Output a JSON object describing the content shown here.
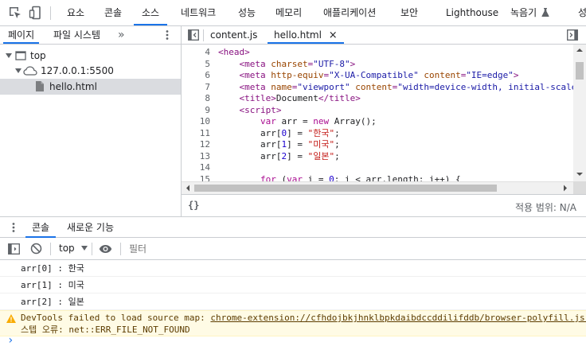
{
  "toolbar_tabs": [
    "요소",
    "콘솔",
    "소스",
    "네트워크",
    "성능",
    "메모리",
    "애플리케이션",
    "보안",
    "Lighthouse",
    "녹음기",
    "성"
  ],
  "active_toolbar_tab": "소스",
  "navigator": {
    "tabs": [
      "페이지",
      "파일 시스템"
    ],
    "more": "»",
    "tree": {
      "top": "top",
      "origin": "127.0.0.1:5500",
      "file": "hello.html"
    }
  },
  "editor": {
    "tabs": [
      "content.js",
      "hello.html"
    ],
    "close": "×",
    "lines": [
      {
        "n": "4",
        "parts": [
          [
            "tg",
            "<head>"
          ]
        ]
      },
      {
        "n": "5",
        "parts": [
          [
            "",
            "    "
          ],
          [
            "tg",
            "<meta "
          ],
          [
            "an",
            "charset"
          ],
          [
            "tg",
            "="
          ],
          [
            "av",
            "\"UTF-8\""
          ],
          [
            "tg",
            ">"
          ]
        ]
      },
      {
        "n": "6",
        "parts": [
          [
            "",
            "    "
          ],
          [
            "tg",
            "<meta "
          ],
          [
            "an",
            "http-equiv"
          ],
          [
            "tg",
            "="
          ],
          [
            "av",
            "\"X-UA-Compatible\""
          ],
          [
            "tg",
            " "
          ],
          [
            "an",
            "content"
          ],
          [
            "tg",
            "="
          ],
          [
            "av",
            "\"IE=edge\""
          ],
          [
            "tg",
            ">"
          ]
        ]
      },
      {
        "n": "7",
        "parts": [
          [
            "",
            "    "
          ],
          [
            "tg",
            "<meta "
          ],
          [
            "an",
            "name"
          ],
          [
            "tg",
            "="
          ],
          [
            "av",
            "\"viewport\""
          ],
          [
            "tg",
            " "
          ],
          [
            "an",
            "content"
          ],
          [
            "tg",
            "="
          ],
          [
            "av",
            "\"width=device-width, initial-scale"
          ]
        ]
      },
      {
        "n": "8",
        "parts": [
          [
            "",
            "    "
          ],
          [
            "tg",
            "<title>"
          ],
          [
            "",
            "Document"
          ],
          [
            "tg",
            "</title>"
          ]
        ]
      },
      {
        "n": "9",
        "parts": [
          [
            "",
            "    "
          ],
          [
            "tg",
            "<script>"
          ]
        ]
      },
      {
        "n": "10",
        "parts": [
          [
            "",
            "        "
          ],
          [
            "kw",
            "var"
          ],
          [
            "",
            " arr = "
          ],
          [
            "kw",
            "new"
          ],
          [
            "",
            " Array();"
          ]
        ]
      },
      {
        "n": "11",
        "parts": [
          [
            "",
            "        arr["
          ],
          [
            "nm",
            "0"
          ],
          [
            "",
            "] = "
          ],
          [
            "st",
            "\"한국\""
          ],
          [
            "",
            ";"
          ]
        ]
      },
      {
        "n": "12",
        "parts": [
          [
            "",
            "        arr["
          ],
          [
            "nm",
            "1"
          ],
          [
            "",
            "] = "
          ],
          [
            "st",
            "\"미국\""
          ],
          [
            "",
            ";"
          ]
        ]
      },
      {
        "n": "13",
        "parts": [
          [
            "",
            "        arr["
          ],
          [
            "nm",
            "2"
          ],
          [
            "",
            "] = "
          ],
          [
            "st",
            "\"일본\""
          ],
          [
            "",
            ";"
          ]
        ]
      },
      {
        "n": "14",
        "parts": []
      },
      {
        "n": "15",
        "parts": [
          [
            "",
            "        "
          ],
          [
            "kw",
            "for"
          ],
          [
            "",
            " ("
          ],
          [
            "kw",
            "var"
          ],
          [
            "",
            " i = "
          ],
          [
            "nm",
            "0"
          ],
          [
            "",
            "; i < arr.length; i++) {"
          ]
        ]
      }
    ],
    "status_left": "{}",
    "status_right": "적용 범위: N/A"
  },
  "drawer": {
    "tabs": [
      "콘솔",
      "새로운 기능"
    ],
    "context": "top",
    "filter_placeholder": "필터"
  },
  "console": {
    "logs": [
      "arr[0] : 한국",
      "arr[1] : 미국",
      "arr[2] : 일본"
    ],
    "warning": {
      "prefix": "DevTools failed to load source map: ",
      "link": "chrome-extension://cfhdojbkjhnklbpkdaibdccddilifddb/browser-polyfill.js.",
      "detail": "스텝 오류: net::ERR_FILE_NOT_FOUND"
    },
    "prompt": "›"
  },
  "colors": {
    "accent": "#1a73e8",
    "warning_bg": "#fffbe5",
    "warning_icon": "#f9ab00",
    "selected_row": "#dadce0"
  },
  "icons": [
    "inspect-element-icon",
    "device-toolbar-icon",
    "record-icon",
    "more-vertical-icon",
    "toggle-navigator-icon",
    "toggle-debugger-icon",
    "folder-icon",
    "cloud-icon",
    "file-icon",
    "pretty-print-icon",
    "sidebar-toggle-icon",
    "clear-console-icon",
    "eye-icon",
    "warning-icon",
    "chevron-right-icon"
  ]
}
